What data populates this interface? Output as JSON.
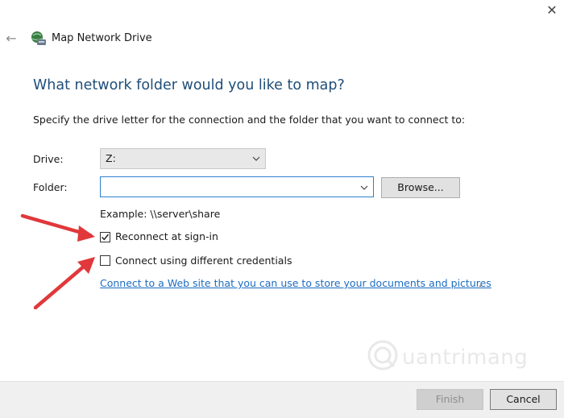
{
  "window": {
    "title": "Map Network Drive",
    "close_glyph": "✕",
    "back_glyph": "←"
  },
  "page": {
    "heading": "What network folder would you like to map?",
    "description": "Specify the drive letter for the connection and the folder that you want to connect to:"
  },
  "form": {
    "drive_label": "Drive:",
    "drive_value": "Z:",
    "folder_label": "Folder:",
    "folder_value": "",
    "browse_label": "Browse...",
    "example_text": "Example: \\\\server\\share",
    "reconnect_label": "Reconnect at sign-in",
    "reconnect_checked": true,
    "credentials_label": "Connect using different credentials",
    "credentials_checked": false,
    "web_link_text": "Connect to a Web site that you can use to store your documents and pictures"
  },
  "footer": {
    "finish_label": "Finish",
    "cancel_label": "Cancel"
  },
  "watermark": {
    "text": "uantrimang"
  },
  "colors": {
    "heading": "#1f4e79",
    "link": "#1c6cc1",
    "annotation_arrow": "#e0383b"
  },
  "icons": {
    "title_icon": "network-drive-icon",
    "back": "back-arrow-icon",
    "close": "close-icon",
    "chevron": "chevron-down-icon",
    "check": "check-icon"
  }
}
